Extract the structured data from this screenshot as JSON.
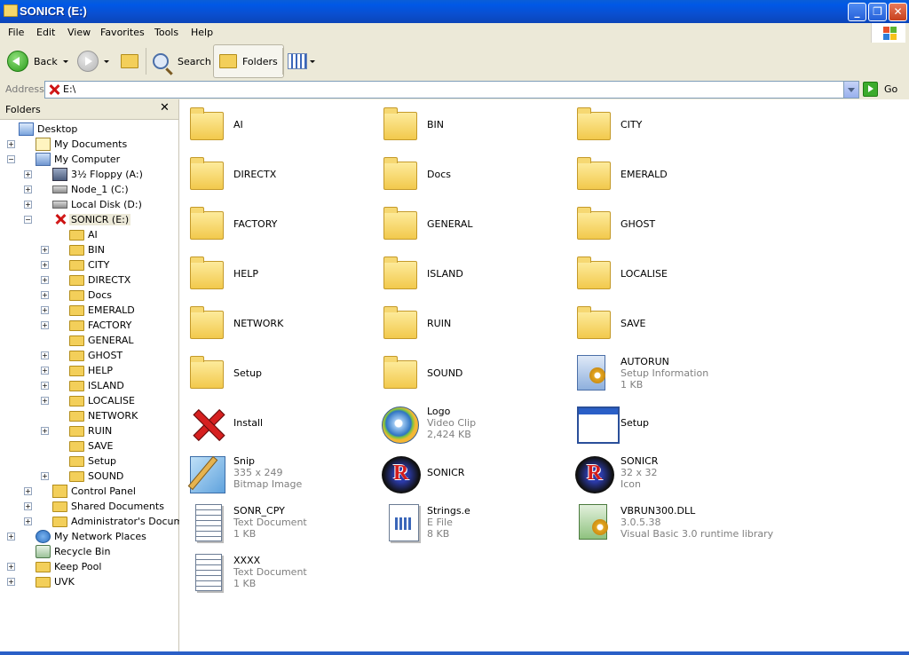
{
  "window": {
    "title": "SONICR (E:)"
  },
  "menu": [
    "File",
    "Edit",
    "View",
    "Favorites",
    "Tools",
    "Help"
  ],
  "toolbar": {
    "back": "Back",
    "search": "Search",
    "folders": "Folders"
  },
  "address": {
    "label": "Address",
    "value": "E:\\",
    "go": "Go"
  },
  "folder_pane": {
    "title": "Folders",
    "close": "✕",
    "tree": [
      {
        "label": "Desktop"
      },
      {
        "label": "My Documents"
      },
      {
        "label": "My Computer"
      },
      {
        "label": "3½ Floppy (A:)"
      },
      {
        "label": "Node_1 (C:)"
      },
      {
        "label": "Local Disk (D:)"
      },
      {
        "label": "SONICR (E:)"
      },
      {
        "label": "AI"
      },
      {
        "label": "BIN"
      },
      {
        "label": "CITY"
      },
      {
        "label": "DIRECTX"
      },
      {
        "label": "Docs"
      },
      {
        "label": "EMERALD"
      },
      {
        "label": "FACTORY"
      },
      {
        "label": "GENERAL"
      },
      {
        "label": "GHOST"
      },
      {
        "label": "HELP"
      },
      {
        "label": "ISLAND"
      },
      {
        "label": "LOCALISE"
      },
      {
        "label": "NETWORK"
      },
      {
        "label": "RUIN"
      },
      {
        "label": "SAVE"
      },
      {
        "label": "Setup"
      },
      {
        "label": "SOUND"
      },
      {
        "label": "Control Panel"
      },
      {
        "label": "Shared Documents"
      },
      {
        "label": "Administrator's Documents"
      },
      {
        "label": "My Network Places"
      },
      {
        "label": "Recycle Bin"
      },
      {
        "label": "Keep Pool"
      },
      {
        "label": "UVK"
      }
    ]
  },
  "files": [
    {
      "name": "AI"
    },
    {
      "name": "BIN"
    },
    {
      "name": "CITY"
    },
    {
      "name": "DIRECTX"
    },
    {
      "name": "Docs"
    },
    {
      "name": "EMERALD"
    },
    {
      "name": "FACTORY"
    },
    {
      "name": "GENERAL"
    },
    {
      "name": "GHOST"
    },
    {
      "name": "HELP"
    },
    {
      "name": "ISLAND"
    },
    {
      "name": "LOCALISE"
    },
    {
      "name": "NETWORK"
    },
    {
      "name": "RUIN"
    },
    {
      "name": "SAVE"
    },
    {
      "name": "Setup"
    },
    {
      "name": "SOUND"
    },
    {
      "name": "AUTORUN",
      "type": "Setup Information",
      "size": "1 KB"
    },
    {
      "name": "Install"
    },
    {
      "name": "Logo",
      "type": "Video Clip",
      "size": "2,424 KB"
    },
    {
      "name": "Setup"
    },
    {
      "name": "Snip",
      "type": "335 x 249",
      "size": "Bitmap Image"
    },
    {
      "name": "SONICR"
    },
    {
      "name": "SONICR",
      "type": "32 x 32",
      "size": "Icon"
    },
    {
      "name": "SONR_CPY",
      "type": "Text Document",
      "size": "1 KB"
    },
    {
      "name": "Strings.e",
      "type": "E File",
      "size": "8 KB"
    },
    {
      "name": "VBRUN300.DLL",
      "type": "3.0.5.38",
      "size": "Visual Basic 3.0 runtime library"
    },
    {
      "name": "XXXX",
      "type": "Text Document",
      "size": "1 KB"
    }
  ]
}
